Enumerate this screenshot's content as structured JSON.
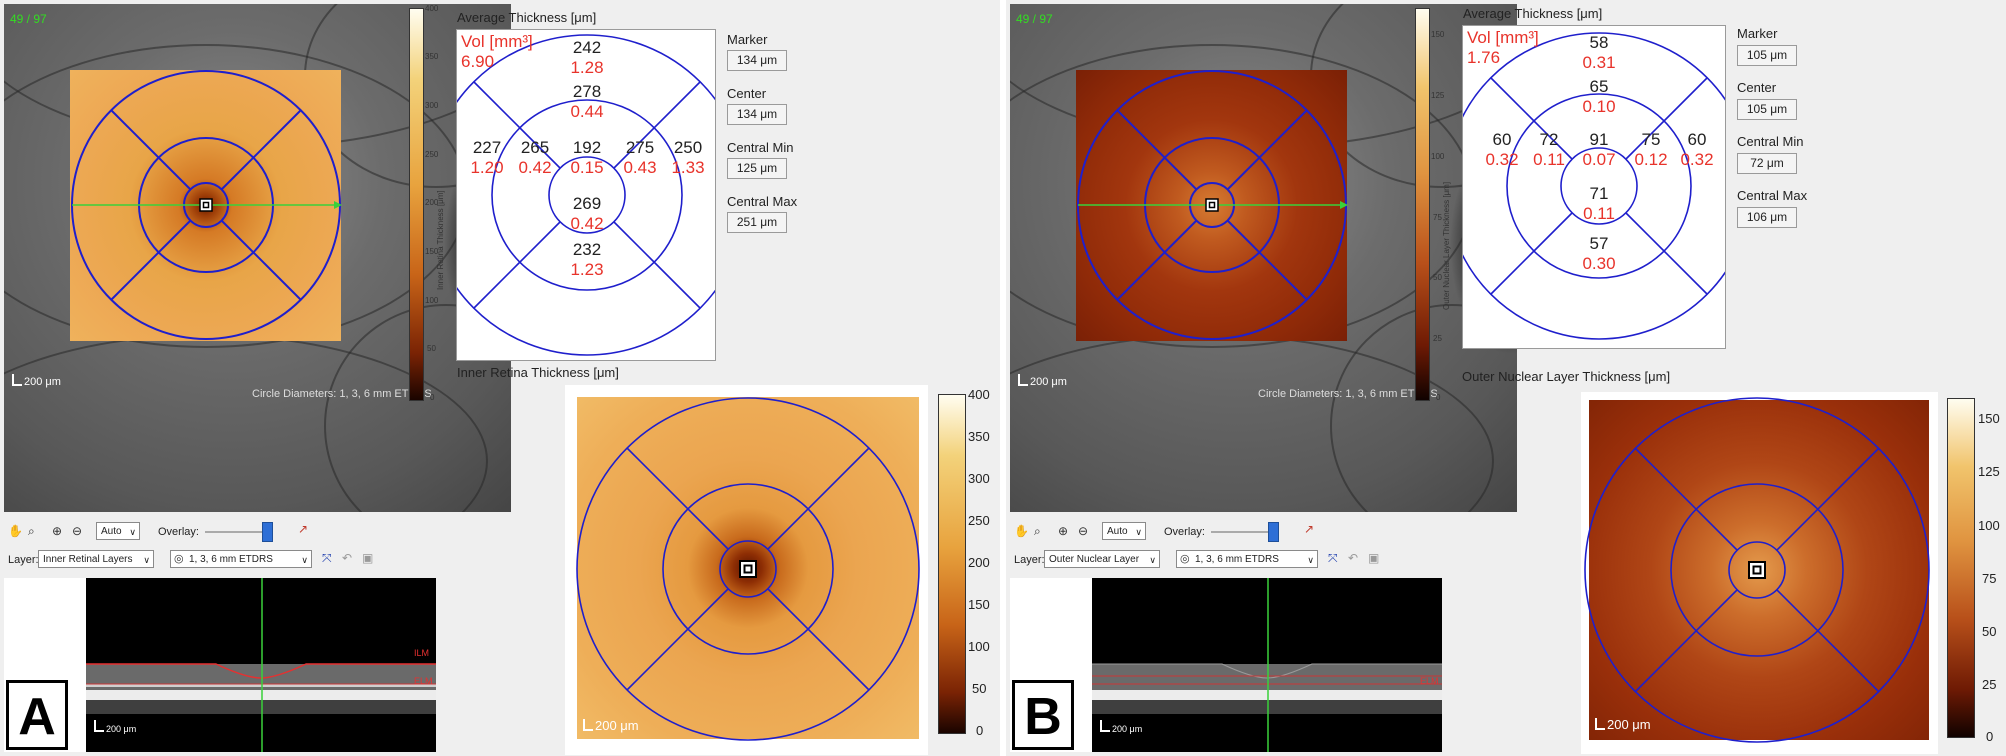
{
  "panels": [
    {
      "id": "A",
      "letter": "A",
      "counter": "49 / 97",
      "fundus_scale": "200 μm",
      "circle_diameters": "Circle Diameters: 1, 3, 6 mm ETDRS",
      "colorbar_small": {
        "ticks": [
          "400",
          "350",
          "300",
          "250",
          "200",
          "150",
          "100",
          "50",
          "0"
        ],
        "label": "Inner Retina Thickness [μm]"
      },
      "avg_title": "Average Thickness [μm]",
      "vol_label": "Vol [mm³]",
      "vol_value": "6.90",
      "sectors": {
        "outer_top": {
          "v": "242",
          "r": "1.28"
        },
        "inner_top": {
          "v": "278",
          "r": "0.44"
        },
        "outer_left": {
          "v": "227",
          "r": "1.20"
        },
        "inner_left": {
          "v": "265",
          "r": "0.42"
        },
        "center": {
          "v": "192",
          "r": "0.15"
        },
        "inner_right": {
          "v": "275",
          "r": "0.43"
        },
        "outer_right": {
          "v": "250",
          "r": "1.33"
        },
        "inner_bottom": {
          "v": "269",
          "r": "0.42"
        },
        "outer_bottom": {
          "v": "232",
          "r": "1.23"
        }
      },
      "metrics": [
        {
          "label": "Marker",
          "value": "134 μm"
        },
        {
          "label": "Center",
          "value": "134 μm"
        },
        {
          "label": "Central Min",
          "value": "125 μm"
        },
        {
          "label": "Central Max",
          "value": "251 μm"
        }
      ],
      "map_title": "Inner Retina Thickness [μm]",
      "map_scale": "200 μm",
      "colorbar_big": {
        "ticks": [
          "400",
          "350",
          "300",
          "250",
          "200",
          "150",
          "100",
          "50",
          "0"
        ]
      },
      "toolbar": {
        "zoom": "Auto",
        "overlay_label": "Overlay:",
        "layer_label": "Layer:",
        "layer_value": "Inner Retinal Layers",
        "grid_value": "1, 3, 6 mm ETDRS"
      },
      "bscan": {
        "scale": "200 μm",
        "labels": [
          "ILM",
          "ELM"
        ]
      }
    },
    {
      "id": "B",
      "letter": "B",
      "counter": "49 / 97",
      "fundus_scale": "200 μm",
      "circle_diameters": "Circle Diameters: 1, 3, 6 mm ETDRS",
      "colorbar_small": {
        "ticks": [
          "150",
          "125",
          "100",
          "75",
          "50",
          "25",
          "0"
        ],
        "label": "Outer Nuclear Layer Thickness [μm]"
      },
      "avg_title": "Average Thickness [μm]",
      "vol_label": "Vol [mm³]",
      "vol_value": "1.76",
      "sectors": {
        "outer_top": {
          "v": "58",
          "r": "0.31"
        },
        "inner_top": {
          "v": "65",
          "r": "0.10"
        },
        "outer_left": {
          "v": "60",
          "r": "0.32"
        },
        "inner_left": {
          "v": "72",
          "r": "0.11"
        },
        "center": {
          "v": "91",
          "r": "0.07"
        },
        "inner_right": {
          "v": "75",
          "r": "0.12"
        },
        "outer_right": {
          "v": "60",
          "r": "0.32"
        },
        "inner_bottom": {
          "v": "71",
          "r": "0.11"
        },
        "outer_bottom": {
          "v": "57",
          "r": "0.30"
        }
      },
      "metrics": [
        {
          "label": "Marker",
          "value": "105 μm"
        },
        {
          "label": "Center",
          "value": "105 μm"
        },
        {
          "label": "Central Min",
          "value": "72 μm"
        },
        {
          "label": "Central Max",
          "value": "106 μm"
        }
      ],
      "map_title": "Outer Nuclear Layer Thickness [μm]",
      "map_scale": "200 μm",
      "colorbar_big": {
        "ticks": [
          "150",
          "125",
          "100",
          "75",
          "50",
          "25",
          "0"
        ]
      },
      "toolbar": {
        "zoom": "Auto",
        "overlay_label": "Overlay:",
        "layer_label": "Layer:",
        "layer_value": "Outer Nuclear Layer",
        "grid_value": "1, 3, 6 mm ETDRS"
      },
      "bscan": {
        "scale": "200 μm",
        "labels": [
          "ELM"
        ]
      }
    }
  ],
  "colors": {
    "grid": "#1f1fcc",
    "scanline": "#3ad13a",
    "accent_red": "#e8332b",
    "slider": "#2e6fd6"
  },
  "icons": [
    "hand-icon",
    "zoom-icon",
    "zoom-in-icon",
    "zoom-out-icon",
    "colormap-icon",
    "expand-icon",
    "undo-icon",
    "save-icon",
    "grid-icon"
  ]
}
